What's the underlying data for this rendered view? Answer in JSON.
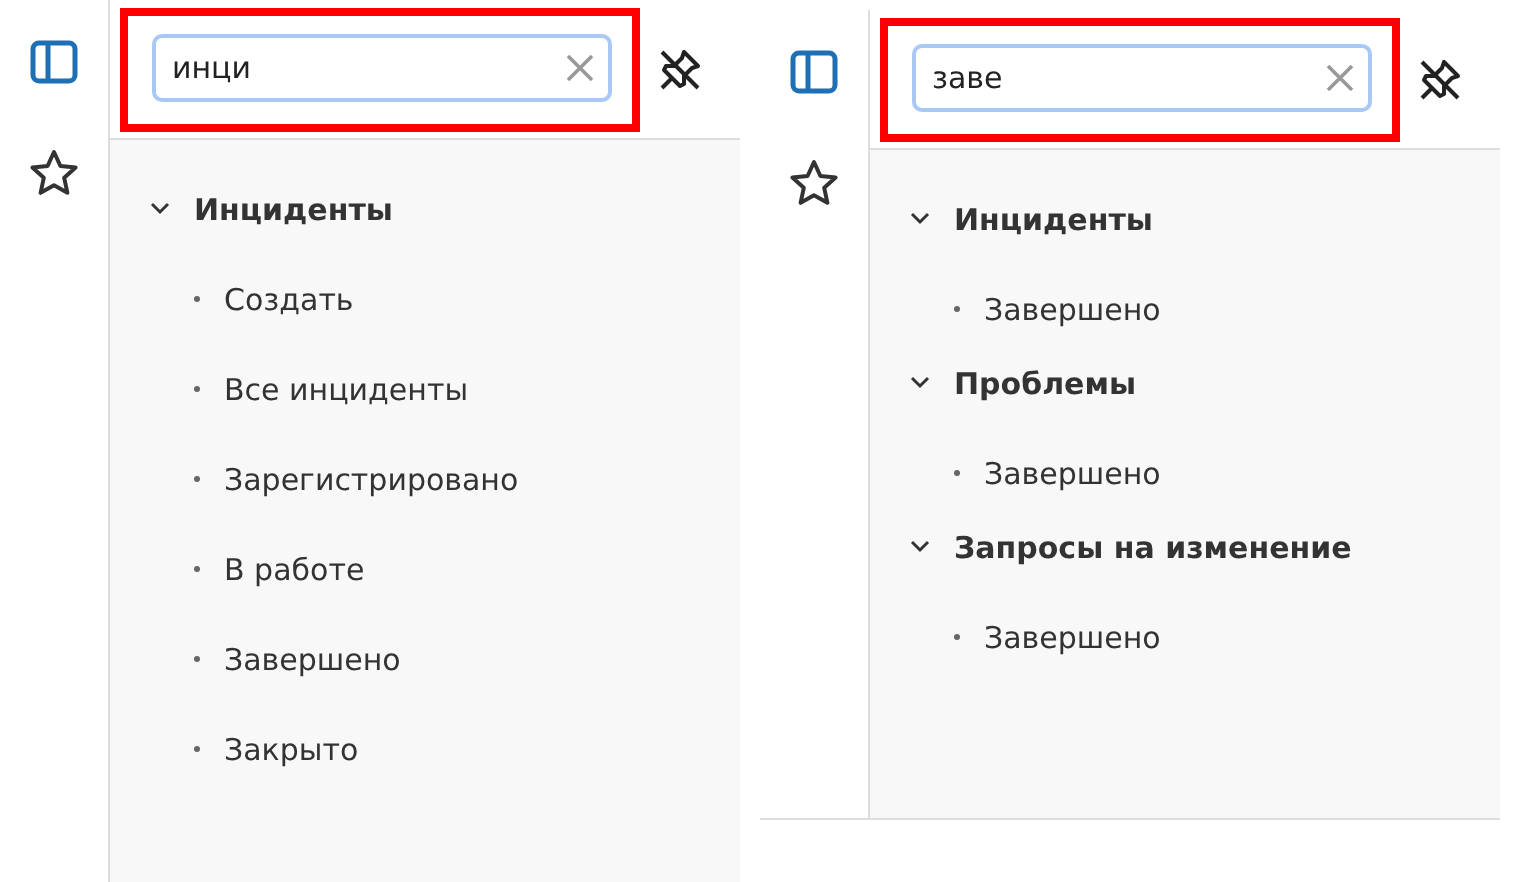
{
  "panels": [
    {
      "search": {
        "value": "инци",
        "highlighted": true
      },
      "groups": [
        {
          "label": "Инциденты",
          "expanded": true,
          "items": [
            "Создать",
            "Все инциденты",
            "Зарегистрировано",
            "В работе",
            "Завершено",
            "Закрыто"
          ]
        }
      ]
    },
    {
      "search": {
        "value": "заве",
        "highlighted": true
      },
      "groups": [
        {
          "label": "Инциденты",
          "expanded": true,
          "items": [
            "Завершено"
          ]
        },
        {
          "label": "Проблемы",
          "expanded": true,
          "items": [
            "Завершено"
          ]
        },
        {
          "label": "Запросы на изменение",
          "expanded": true,
          "items": [
            "Завершено"
          ]
        }
      ]
    }
  ]
}
